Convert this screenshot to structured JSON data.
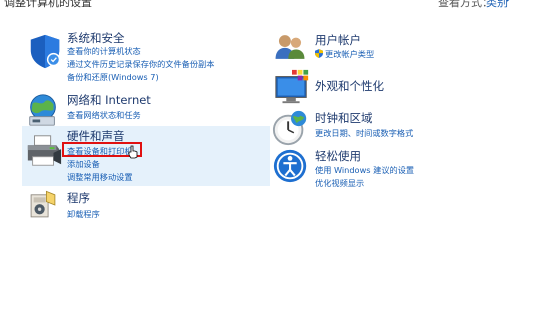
{
  "header": {
    "title": "调整计算机的设置",
    "view_by_label": "查看方式：",
    "view_by_value": "类别"
  },
  "left_categories": [
    {
      "title": "系统和安全",
      "icon": "shield-icon",
      "links": [
        "查看你的计算机状态",
        "通过文件历史记录保存你的文件备份副本",
        "备份和还原(Windows 7)"
      ]
    },
    {
      "title": "网络和 Internet",
      "icon": "network-globe-icon",
      "links": [
        "查看网络状态和任务"
      ]
    },
    {
      "title": "硬件和声音",
      "icon": "printer-icon",
      "links": [
        "查看设备和打印机",
        "添加设备",
        "调整常用移动设置"
      ]
    },
    {
      "title": "程序",
      "icon": "programs-icon",
      "links": [
        "卸载程序"
      ]
    }
  ],
  "right_categories": [
    {
      "title": "用户帐户",
      "icon": "users-icon",
      "links": [
        "更改帐户类型"
      ]
    },
    {
      "title": "外观和个性化",
      "icon": "appearance-icon",
      "links": []
    },
    {
      "title": "时钟和区域",
      "icon": "clock-icon",
      "links": [
        "更改日期、时间或数字格式"
      ]
    },
    {
      "title": "轻松使用",
      "icon": "ease-of-access-icon",
      "links": [
        "使用 Windows 建议的设置",
        "优化视频显示"
      ]
    }
  ],
  "colors": {
    "link": "#1a5fb4",
    "title": "#1e3a6e",
    "highlight_bg": "#e5f1fb",
    "annotation_red": "#e01010"
  }
}
